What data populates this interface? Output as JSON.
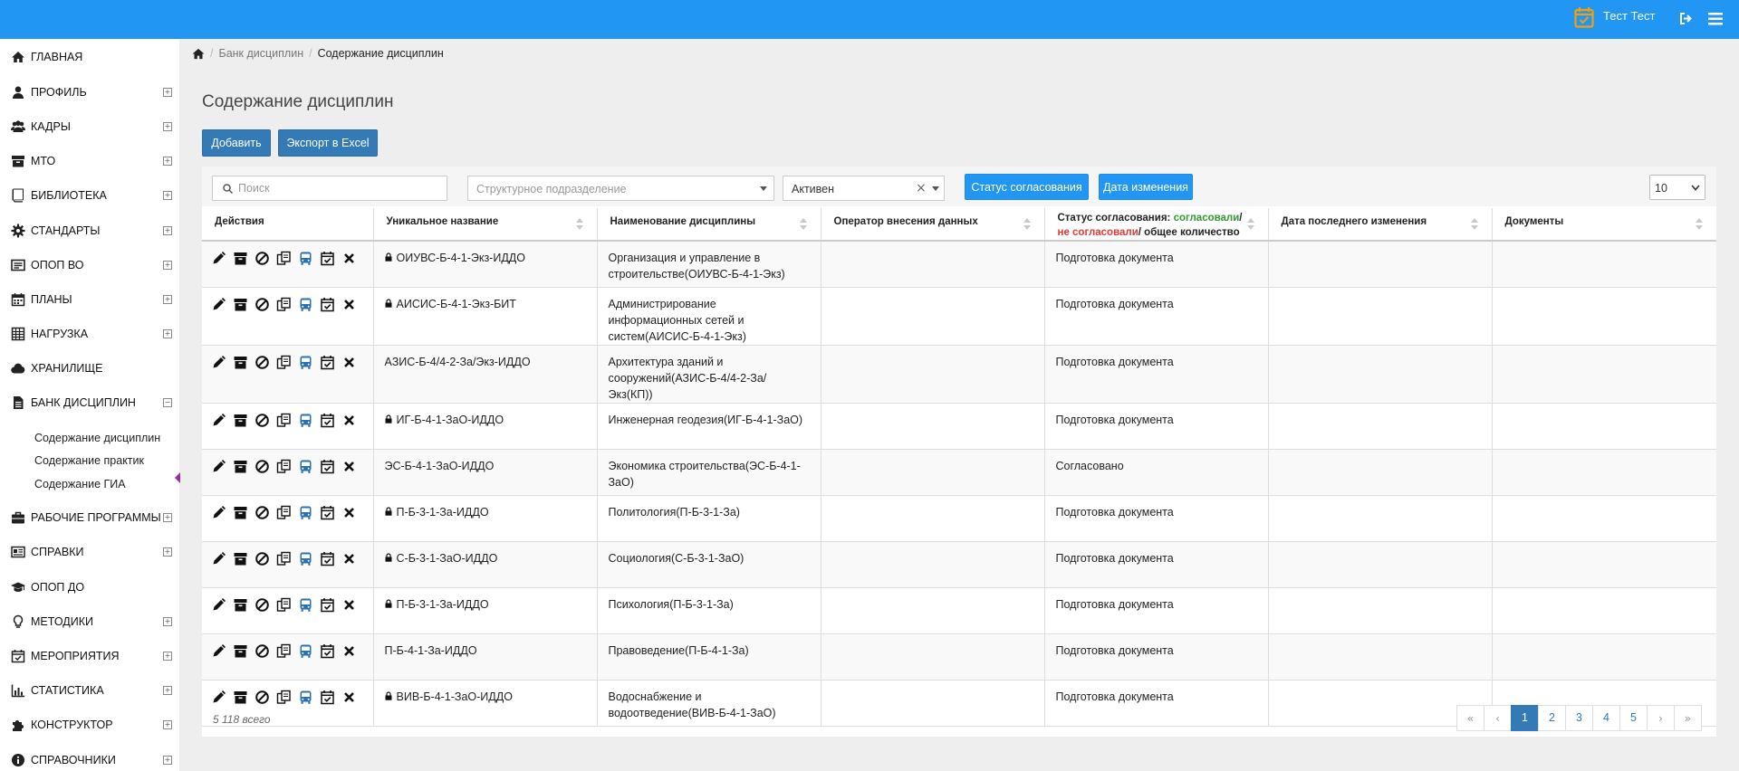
{
  "header": {
    "user_name": "Тест Тест",
    "icons": [
      "calendar-icon",
      "logout-icon",
      "menu-icon"
    ],
    "bar_color": "#2196f3"
  },
  "sidebar": {
    "items": [
      {
        "label": "ГЛАВНАЯ",
        "icon": "home-icon",
        "expand": ""
      },
      {
        "label": "ПРОФИЛЬ",
        "icon": "user-icon",
        "expand": "+"
      },
      {
        "label": "КАДРЫ",
        "icon": "users-icon",
        "expand": "+"
      },
      {
        "label": "МТО",
        "icon": "archive-icon",
        "expand": "+"
      },
      {
        "label": "БИБЛИОТЕКА",
        "icon": "book-icon",
        "expand": "+"
      },
      {
        "label": "СТАНДАРТЫ",
        "icon": "gear-icon",
        "expand": "+"
      },
      {
        "label": "ОПОП ВО",
        "icon": "card-icon",
        "expand": "+"
      },
      {
        "label": "ПЛАНЫ",
        "icon": "calendar-icon",
        "expand": "+"
      },
      {
        "label": "НАГРУЗКА",
        "icon": "table-icon",
        "expand": "+"
      },
      {
        "label": "ХРАНИЛИЩЕ",
        "icon": "cloud-icon",
        "expand": ""
      },
      {
        "label": "БАНК ДИСЦИПЛИН",
        "icon": "file-icon",
        "expand": "−"
      }
    ],
    "subitems": [
      "Содержание дисциплин",
      "Содержание практик",
      "Содержание ГИА"
    ],
    "items_after": [
      {
        "label": "РАБОЧИЕ ПРОГРАММЫ",
        "icon": "briefcase-icon",
        "expand": "+"
      },
      {
        "label": "СПРАВКИ",
        "icon": "newspaper-icon",
        "expand": "+"
      },
      {
        "label": "ОПОП ДО",
        "icon": "graduation-cap-icon",
        "expand": ""
      },
      {
        "label": "МЕТОДИКИ",
        "icon": "lightbulb-icon",
        "expand": "+"
      },
      {
        "label": "МЕРОПРИЯТИЯ",
        "icon": "calendar-check-icon",
        "expand": "+"
      },
      {
        "label": "СТАТИСТИКА",
        "icon": "bar-chart-icon",
        "expand": "+"
      },
      {
        "label": "КОНСТРУКТОР",
        "icon": "puzzle-icon",
        "expand": "+"
      },
      {
        "label": "СПРАВОЧНИКИ",
        "icon": "info-icon",
        "expand": "+"
      }
    ]
  },
  "breadcrumb": [
    "Банк дисциплин",
    "Содержание дисциплин"
  ],
  "page": {
    "title": "Содержание дисциплин",
    "add_button": "Добавить",
    "export_button": "Экспорт в Excel"
  },
  "filters": {
    "search_placeholder": "Поиск",
    "department_placeholder": "Структурное подразделение",
    "status_value": "Активен",
    "approval_button": "Статус согласования",
    "date_button": "Дата изменения",
    "page_size": "10"
  },
  "table": {
    "headers": {
      "actions": "Действия",
      "unique_name": "Уникальное название",
      "discipline_name": "Наименование дисциплины",
      "operator": "Оператор внесения данных",
      "status_prefix": "Статус согласования: ",
      "status_approved": "согласовали",
      "status_slash1": "/ ",
      "status_not": "не согласовали",
      "status_suffix": "/ общее количество",
      "last_changed": "Дата последнего изменения",
      "documents": "Документы"
    },
    "action_icons": [
      "edit-icon",
      "archive-icon",
      "block-icon",
      "copy-icon",
      "bus-icon",
      "calendar-check-icon",
      "close-icon"
    ],
    "rows": [
      {
        "unique": "ОИУВС-Б-4-1-Экз-ИДДО",
        "locked": true,
        "name": "Организация и управление в строительстве(ОИУВС-Б-4-1-Экз)",
        "operator": "",
        "status": "Подготовка документа",
        "date": "",
        "docs": ""
      },
      {
        "unique": "АИСИС-Б-4-1-Экз-БИТ",
        "locked": true,
        "name": "Администрирование информационных сетей и систем(АИСИС-Б-4-1-Экз)",
        "operator": "",
        "status": "Подготовка документа",
        "date": "",
        "docs": ""
      },
      {
        "unique": "АЗИС-Б-4/4-2-За/Экз-ИДДО",
        "locked": false,
        "name": "Архитектура зданий и сооружений(АЗИС-Б-4/4-2-За/Экз(КП))",
        "operator": "",
        "status": "Подготовка документа",
        "date": "",
        "docs": ""
      },
      {
        "unique": "ИГ-Б-4-1-ЗаО-ИДДО",
        "locked": true,
        "name": "Инженерная геодезия(ИГ-Б-4-1-ЗаО)",
        "operator": "",
        "status": "Подготовка документа",
        "date": "",
        "docs": ""
      },
      {
        "unique": "ЭС-Б-4-1-ЗаО-ИДДО",
        "locked": false,
        "name": "Экономика строительства(ЭС-Б-4-1-ЗаО)",
        "operator": "",
        "status": "Согласовано",
        "date": "",
        "docs": ""
      },
      {
        "unique": "П-Б-3-1-За-ИДДО",
        "locked": true,
        "name": "Политология(П-Б-3-1-За)",
        "operator": "",
        "status": "Подготовка документа",
        "date": "",
        "docs": ""
      },
      {
        "unique": "С-Б-3-1-ЗаО-ИДДО",
        "locked": true,
        "name": "Социология(С-Б-3-1-ЗаО)",
        "operator": "",
        "status": "Подготовка документа",
        "date": "",
        "docs": ""
      },
      {
        "unique": "П-Б-3-1-За-ИДДО",
        "locked": true,
        "name": "Психология(П-Б-3-1-За)",
        "operator": "",
        "status": "Подготовка документа",
        "date": "",
        "docs": ""
      },
      {
        "unique": "П-Б-4-1-За-ИДДО",
        "locked": false,
        "name": "Правоведение(П-Б-4-1-За)",
        "operator": "",
        "status": "Подготовка документа",
        "date": "",
        "docs": ""
      },
      {
        "unique": "ВИВ-Б-4-1-ЗаО-ИДДО",
        "locked": true,
        "name": "Водоснабжение и водоотведение(ВИВ-Б-4-1-ЗаО)",
        "operator": "",
        "status": "Подготовка документа",
        "date": "",
        "docs": ""
      }
    ]
  },
  "footer": {
    "total": "5 118 всего",
    "pages": [
      "«",
      "‹",
      "1",
      "2",
      "3",
      "4",
      "5",
      "›",
      "»"
    ],
    "active_page": "1"
  },
  "colors": {
    "primary": "#2196f3",
    "dark_button": "#337ab7",
    "approved": "#2e9b2e",
    "not_approved": "#e53935"
  }
}
